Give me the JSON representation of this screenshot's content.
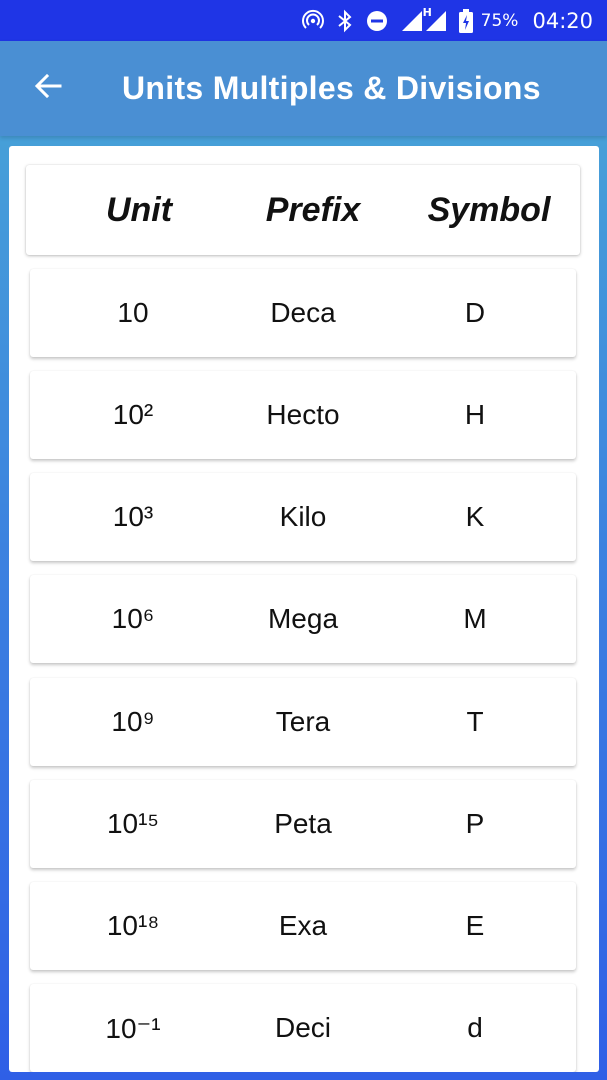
{
  "status_bar": {
    "icons": [
      "hotspot-icon",
      "bluetooth-icon",
      "do-not-disturb-icon",
      "signal-icon",
      "signal-h-icon",
      "battery-charging-icon"
    ],
    "network_label": "H",
    "battery_percent": "75%",
    "time": "04:20"
  },
  "app_bar": {
    "back_icon": "arrow-left-icon",
    "title": "Units Multiples & Divisions"
  },
  "table": {
    "headers": {
      "unit": "Unit",
      "prefix": "Prefix",
      "symbol": "Symbol"
    },
    "rows": [
      {
        "unit": "10",
        "prefix": "Deca",
        "symbol": "D"
      },
      {
        "unit": "10²",
        "prefix": "Hecto",
        "symbol": "H"
      },
      {
        "unit": "10³",
        "prefix": "Kilo",
        "symbol": "K"
      },
      {
        "unit": "10⁶",
        "prefix": "Mega",
        "symbol": "M"
      },
      {
        "unit": "10⁹",
        "prefix": "Tera",
        "symbol": "T"
      },
      {
        "unit": "10¹⁵",
        "prefix": "Peta",
        "symbol": "P"
      },
      {
        "unit": "10¹⁸",
        "prefix": "Exa",
        "symbol": "E"
      },
      {
        "unit": "10⁻¹",
        "prefix": "Deci",
        "symbol": "d"
      }
    ]
  },
  "colors": {
    "status_bar": "#1f35e6",
    "app_bar": "#4a8fd3",
    "background_top": "#4aa9d6",
    "background_bottom": "#2f5fe6"
  }
}
